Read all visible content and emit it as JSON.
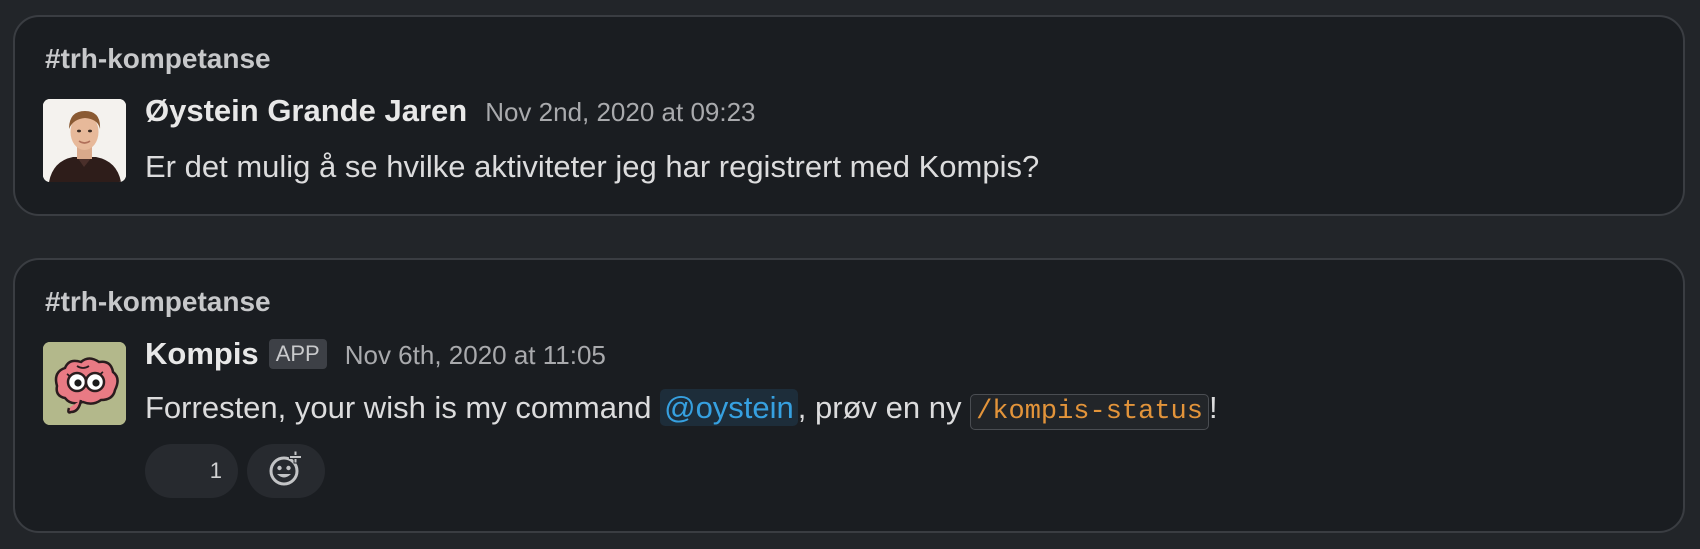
{
  "messages": [
    {
      "channel": "#trh-kompetanse",
      "sender": "Øystein Grande Jaren",
      "timestamp": "Nov 2nd, 2020 at 09:23",
      "text": "Er det mulig å se hvilke aktiviteter jeg har registrert med Kompis?"
    },
    {
      "channel": "#trh-kompetanse",
      "sender": "Kompis",
      "badge": "APP",
      "timestamp": "Nov 6th, 2020 at 11:05",
      "text_before": "Forresten, your wish is my command ",
      "mention": "@oystein",
      "text_middle": ", prøv en ny ",
      "command": "/kompis-status",
      "text_after": "!",
      "reaction_count": "1"
    }
  ],
  "icons": {
    "add_reaction": "add-reaction-icon",
    "avatar_bot": "brain-mascot"
  },
  "colors": {
    "background": "#222529",
    "card": "#1a1d21",
    "mention": "#36a0e0",
    "code": "#e3943a"
  }
}
